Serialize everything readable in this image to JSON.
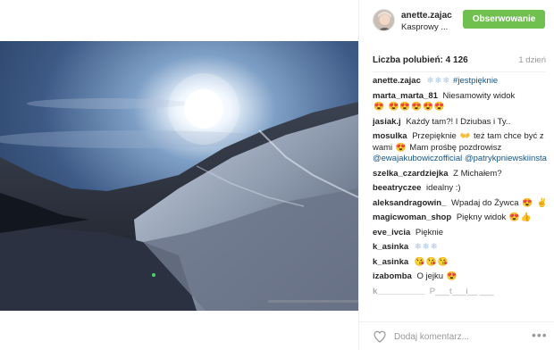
{
  "post": {
    "username": "anette.zajac",
    "location": "Kasprowy ...",
    "follow_label": "Obserwowanie",
    "likes_label": "Liczba polubień: 4 126",
    "time_label": "1 dzień",
    "caption": {
      "user": "anette.zajac",
      "emojis": "❄❄❄",
      "tag": "#jestpięknie"
    }
  },
  "comments": [
    {
      "user": "marta_marta_81",
      "text": "Niesamowity widok",
      "emojis": "😍 😍😍😍😍😍"
    },
    {
      "user": "jasiak.j",
      "text": "Każdy tam?! I Dziubas i Ty..",
      "emojis": ""
    },
    {
      "user": "mosulka",
      "text": "Przepięknie",
      "emoji_mid": "👐",
      "text2": "też tam chce być z wami",
      "emoji2": "😍",
      "text3": "Mam prośbę pozdrowisz",
      "mention1": "@ewajakubowiczofficial",
      "mention2": "@patrykpniewskiinsta"
    },
    {
      "user": "szelka_czardziejka",
      "text": "Z Michałem?",
      "emojis": ""
    },
    {
      "user": "beeatryczee",
      "text": "idealny :)",
      "emojis": ""
    },
    {
      "user": "aleksandragowin_",
      "text": "Wpadaj do Żywca",
      "emojis": "😍 ✌"
    },
    {
      "user": "magicwoman_shop",
      "text": "Piękny widok",
      "emojis": "😍👍"
    },
    {
      "user": "eve_ivcia",
      "text": "Pięknie",
      "emojis": ""
    },
    {
      "user": "k_asinka",
      "text": "",
      "emojis": "❄❄❄"
    },
    {
      "user": "k_asinka",
      "text": "",
      "emojis": "😘😘😘"
    },
    {
      "user": "izabomba",
      "text": "O jejku",
      "emojis": "😍"
    },
    {
      "user": "k__________",
      "text": "P___t___i__ ___",
      "emojis": ""
    }
  ],
  "comment_bar": {
    "placeholder": "Dodaj komentarz...",
    "more": "•••"
  },
  "icons": {
    "heart": "heart-icon",
    "more": "more-options-icon"
  },
  "colors": {
    "follow_button": "#70c050",
    "link": "#125688",
    "muted": "#999999"
  }
}
